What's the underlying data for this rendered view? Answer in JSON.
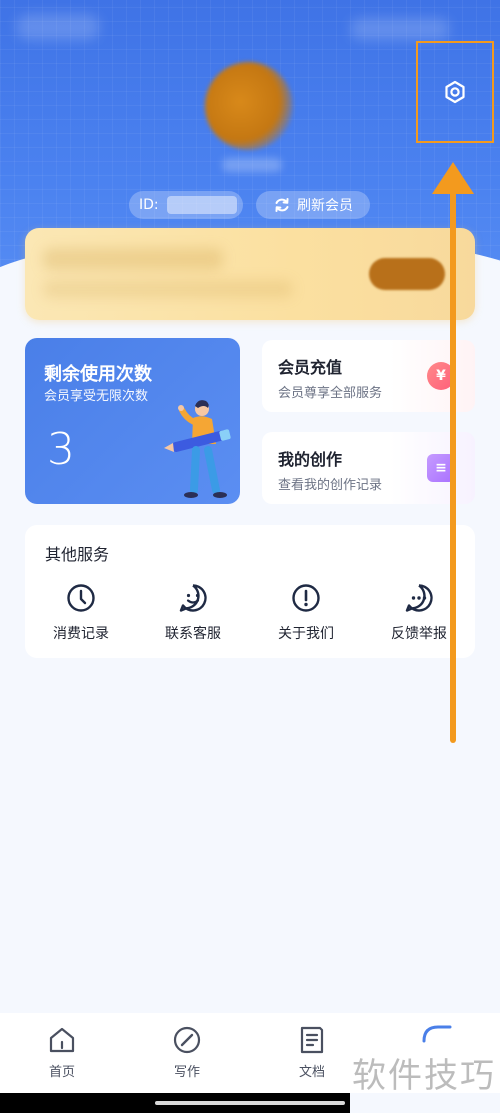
{
  "header": {
    "id_label": "ID:",
    "refresh_label": "刷新会员"
  },
  "usage_card": {
    "title": "剩余使用次数",
    "subtitle": "会员享受无限次数",
    "count": "3"
  },
  "side_cards": [
    {
      "title": "会员充值",
      "subtitle": "会员尊享全部服务",
      "badge": "¥"
    },
    {
      "title": "我的创作",
      "subtitle": "查看我的创作记录",
      "badge": "≡"
    }
  ],
  "services": {
    "title": "其他服务",
    "items": [
      {
        "label": "消费记录",
        "icon": "clock-icon"
      },
      {
        "label": "联系客服",
        "icon": "smile-chat-icon"
      },
      {
        "label": "关于我们",
        "icon": "info-exclamation-icon"
      },
      {
        "label": "反馈举报",
        "icon": "chat-dots-icon"
      }
    ]
  },
  "bottom_nav": {
    "items": [
      {
        "label": "首页",
        "icon": "home-icon"
      },
      {
        "label": "写作",
        "icon": "pen-circle-icon"
      },
      {
        "label": "文档",
        "icon": "document-icon"
      }
    ]
  },
  "watermark": "软件技巧",
  "colors": {
    "primary": "#4a7fe8",
    "annotation": "#f39a1e",
    "vip_gold": "#fbe0a0"
  }
}
